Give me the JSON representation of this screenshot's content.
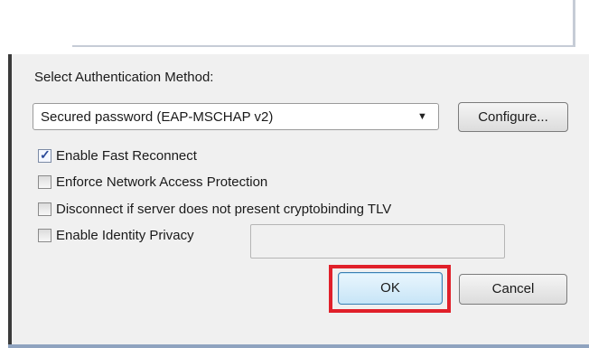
{
  "dialog": {
    "section_label": "Select Authentication Method:",
    "method_select": {
      "value": "Secured password (EAP-MSCHAP v2)"
    },
    "configure_label": "Configure...",
    "options": [
      {
        "label": "Enable Fast Reconnect",
        "checked": true
      },
      {
        "label": "Enforce Network Access Protection",
        "checked": false
      },
      {
        "label": "Disconnect if server does not present cryptobinding TLV",
        "checked": false
      },
      {
        "label": "Enable Identity Privacy",
        "checked": false
      }
    ],
    "identity_privacy_value": "",
    "ok_label": "OK",
    "cancel_label": "Cancel",
    "highlight_color": "#e0202a",
    "default_button_color": "#3c7fb1"
  }
}
